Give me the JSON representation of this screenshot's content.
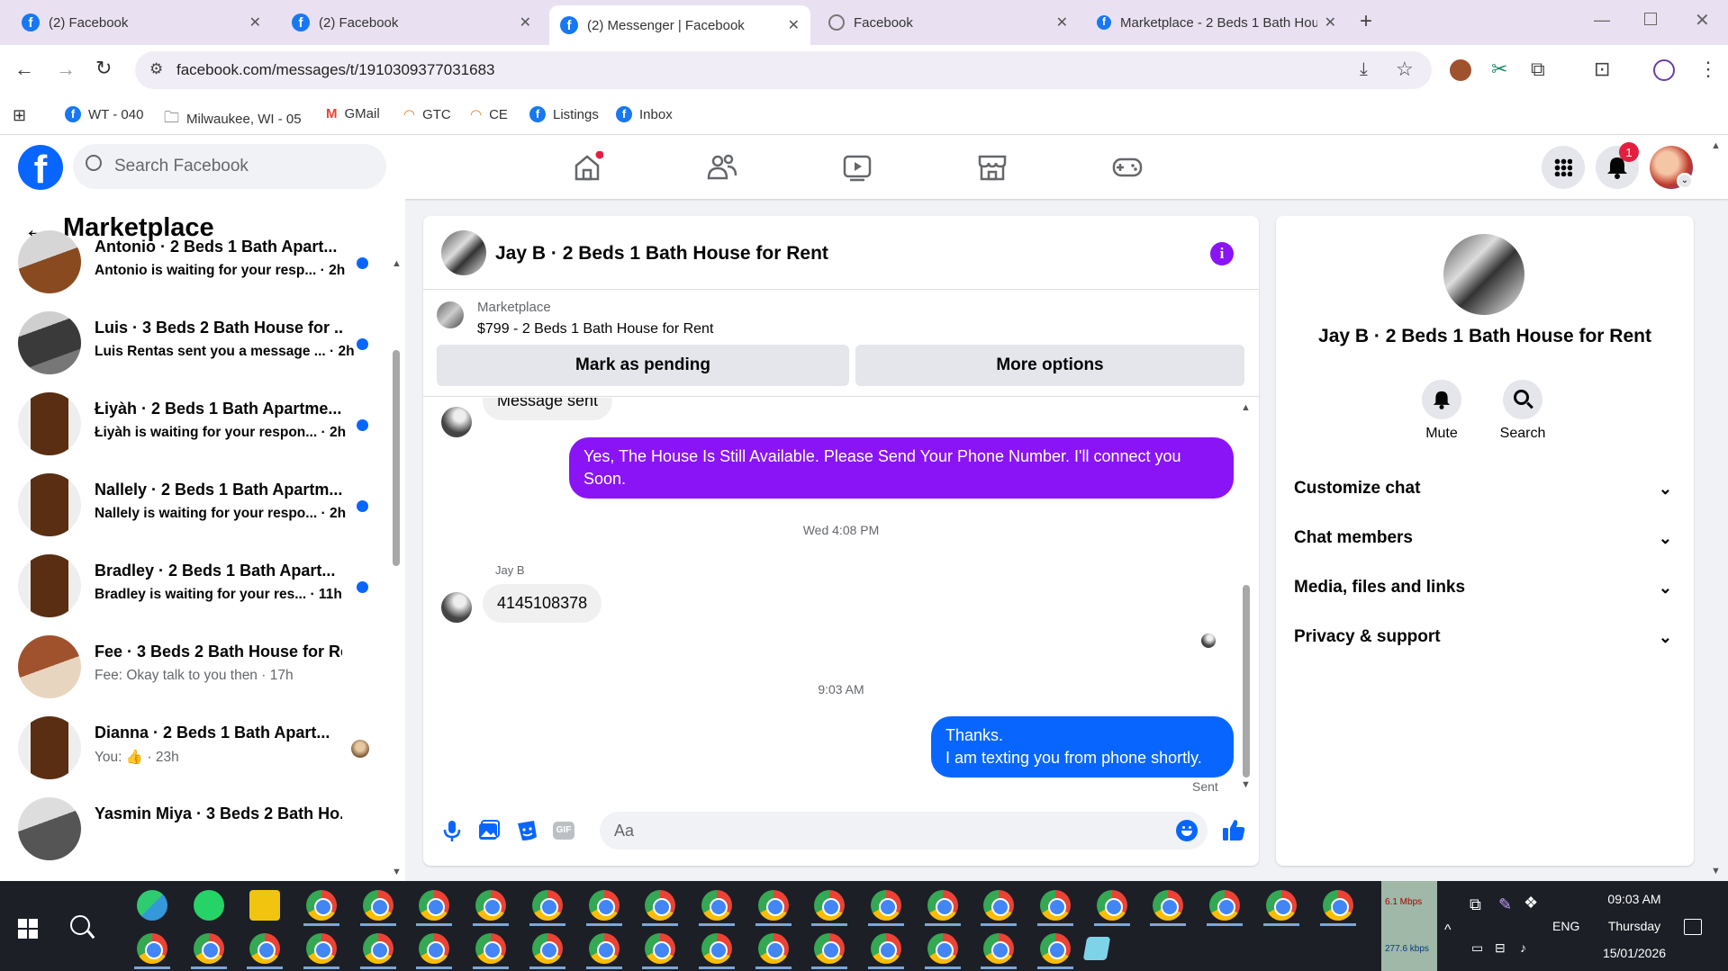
{
  "browser": {
    "tabs": [
      {
        "title": "(2) Facebook"
      },
      {
        "title": "(2) Facebook"
      },
      {
        "title": "(2) Messenger | Facebook"
      },
      {
        "title": "Facebook"
      },
      {
        "title": "Marketplace - 2 Beds 1 Bath House for Rent"
      }
    ],
    "url": "facebook.com/messages/t/1910309377031683",
    "bookmarks": [
      "WT - 040",
      "Milwaukee, WI - 05",
      "GMail",
      "GTC",
      "CE",
      "Listings",
      "Inbox"
    ]
  },
  "header": {
    "search_placeholder": "Search Facebook",
    "notification_count": "1"
  },
  "left": {
    "title": "Marketplace",
    "conversations": [
      {
        "name": "Antonio · 2 Beds 1 Bath Apart...",
        "snippet": "Antonio is waiting for your resp...",
        "time": "· 2h",
        "unread": true
      },
      {
        "name": "Luis · 3 Beds 2 Bath House for ...",
        "snippet": "Luis Rentas sent you a message ...",
        "time": "· 2h",
        "unread": true
      },
      {
        "name": "Łiyàh · 2 Beds 1 Bath Apartme...",
        "snippet": "Łiyàh is waiting for your respon...",
        "time": "· 2h",
        "unread": true
      },
      {
        "name": "Nallely · 2 Beds 1 Bath Apartm...",
        "snippet": "Nallely is waiting for your respo...",
        "time": "· 2h",
        "unread": true
      },
      {
        "name": "Bradley · 2 Beds 1 Bath Apart...",
        "snippet": "Bradley is waiting for your res...",
        "time": "· 11h",
        "unread": true
      },
      {
        "name": "Fee · 3 Beds 2 Bath House for Re...",
        "snippet": "Fee: Okay talk to you then",
        "time": "· 17h",
        "unread": false
      },
      {
        "name": "Dianna · 2 Beds 1 Bath Apart...",
        "snippet": "You:",
        "time": "· 23h",
        "unread": false
      },
      {
        "name": "Yasmin Miya · 3 Beds 2 Bath Ho...",
        "snippet": "",
        "time": "",
        "unread": false
      }
    ]
  },
  "chat": {
    "title": "Jay B · 2 Beds 1 Bath House for Rent",
    "listing_label": "Marketplace",
    "listing_detail": "$799 - 2 Beds 1 Bath House for Rent",
    "mark_pending": "Mark as pending",
    "more_options": "More options",
    "partial_msg": "Message sent",
    "msg_out1": "Yes, The House Is Still Available. Please Send Your Phone Number. I'll connect you Soon.",
    "ts1": "Wed 4:08 PM",
    "sender": "Jay B",
    "msg_in1": "4145108378",
    "ts2": "9:03 AM",
    "msg_out2_line1": "Thanks.",
    "msg_out2_line2": "I am texting you from phone shortly.",
    "sent_status": "Sent",
    "composer_placeholder": "Aa"
  },
  "right": {
    "name": "Jay B · 2 Beds 1 Bath House for Rent",
    "mute": "Mute",
    "search": "Search",
    "sections": [
      "Customize chat",
      "Chat members",
      "Media, files and links",
      "Privacy & support"
    ]
  },
  "taskbar": {
    "net_up": "6.1 Mbps",
    "net_down": "277.6 kbps",
    "lang": "ENG",
    "time": "09:03 AM",
    "day": "Thursday",
    "date": "15/01/2026"
  },
  "colors": {
    "fb_blue": "#0866ff",
    "purple_bubble": "#8a14f6",
    "unread_dot": "#0866ff"
  }
}
